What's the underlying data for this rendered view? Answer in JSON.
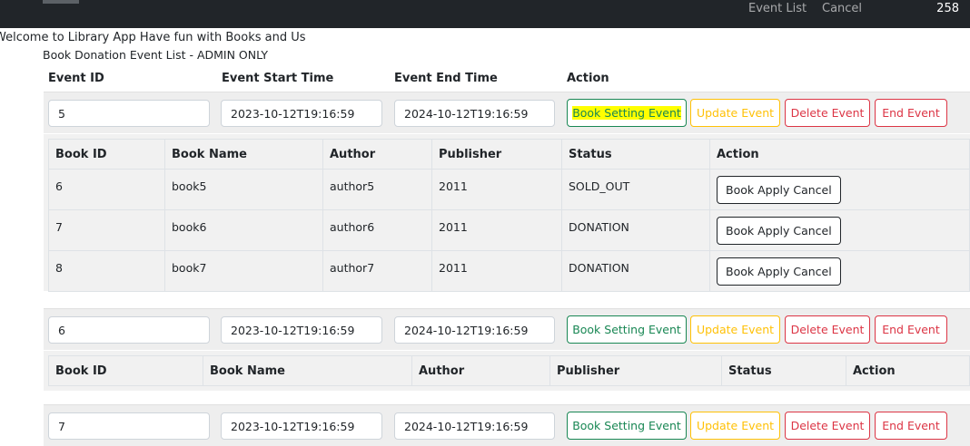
{
  "nav": {
    "links": [
      "Event List",
      "Cancel"
    ],
    "count": "258"
  },
  "welcome": "Welcome to Library App Have fun with Books and Us",
  "subtitle": "Book Donation Event List - ADMIN ONLY",
  "columns": {
    "event_id": "Event ID",
    "start": "Event Start Time",
    "end": "Event End Time",
    "action": "Action"
  },
  "buttons": {
    "book_setting": "Book Setting Event",
    "update": "Update Event",
    "delete": "Delete Event",
    "end": "End Event",
    "apply_cancel": "Book Apply Cancel"
  },
  "book_columns": [
    "Book ID",
    "Book Name",
    "Author",
    "Publisher",
    "Status",
    "Action"
  ],
  "events": [
    {
      "id": "5",
      "start": "2023-10-12T19:16:59",
      "end": "2024-10-12T19:16:59",
      "books": [
        {
          "id": "6",
          "name": "book5",
          "author": "author5",
          "publisher": "2011",
          "status": "SOLD_OUT"
        },
        {
          "id": "7",
          "name": "book6",
          "author": "author6",
          "publisher": "2011",
          "status": "DONATION"
        },
        {
          "id": "8",
          "name": "book7",
          "author": "author7",
          "publisher": "2011",
          "status": "DONATION"
        }
      ]
    },
    {
      "id": "6",
      "start": "2023-10-12T19:16:59",
      "end": "2024-10-12T19:16:59",
      "books": []
    },
    {
      "id": "7",
      "start": "2023-10-12T19:16:59",
      "end": "2024-10-12T19:16:59",
      "books": []
    }
  ],
  "colors": {
    "highlight": "#ffff00",
    "success": "#198754",
    "warning": "#ffc107",
    "danger": "#dc3545",
    "navbar": "#212529"
  }
}
